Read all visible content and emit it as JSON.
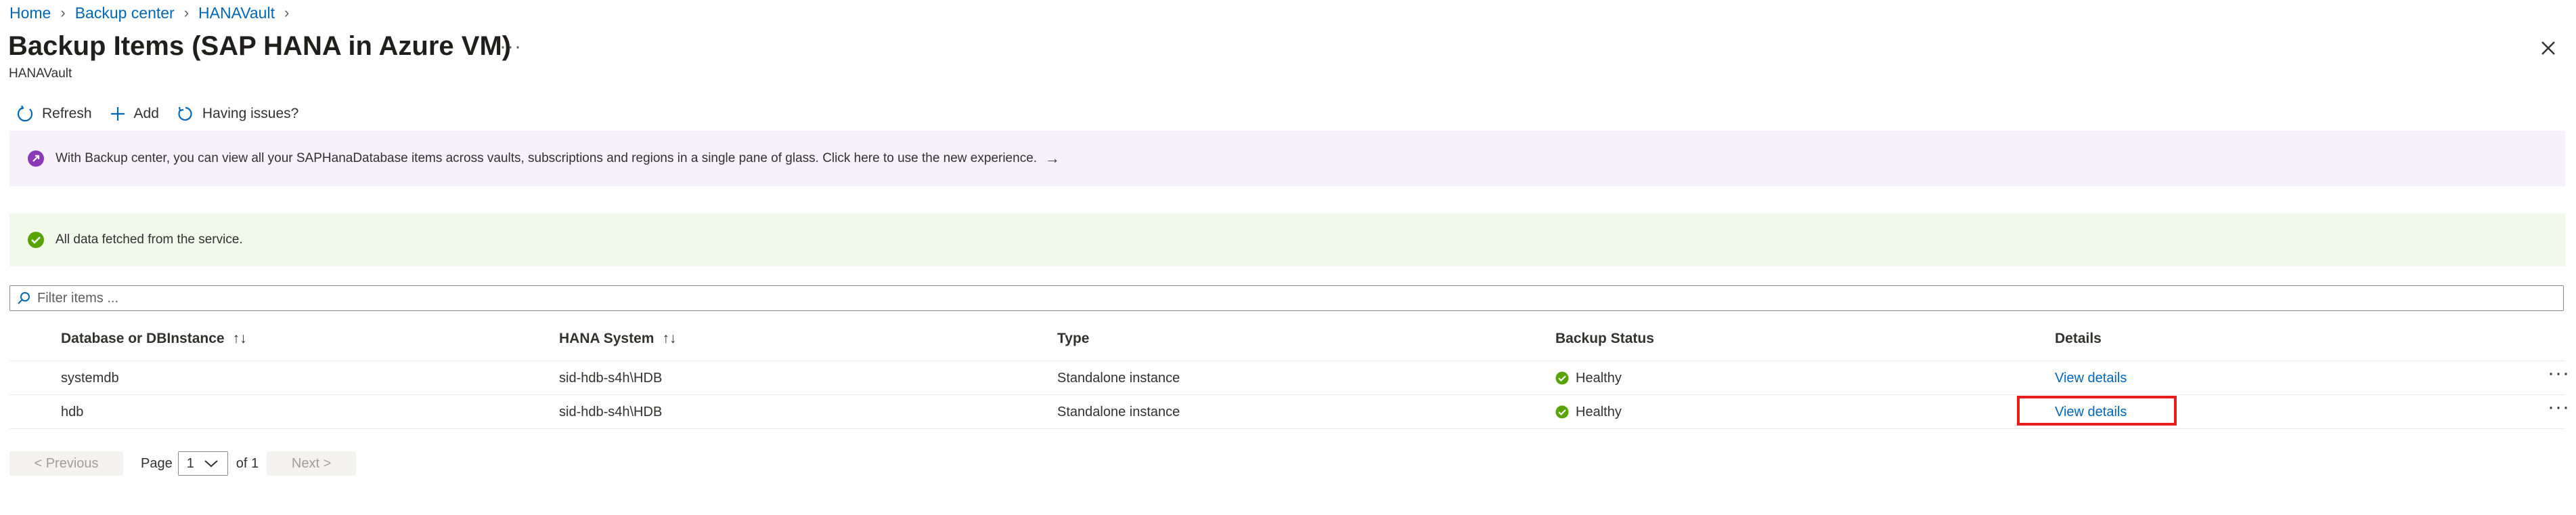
{
  "breadcrumb": [
    "Home",
    "Backup center",
    "HANAVault"
  ],
  "header": {
    "title": "Backup Items (SAP HANA in Azure VM)",
    "more": "···",
    "subtitle": "HANAVault"
  },
  "toolbar": {
    "refresh": "Refresh",
    "add": "Add",
    "issues": "Having issues?"
  },
  "banners": {
    "info": "With Backup center, you can view all your SAPHanaDatabase items across vaults, subscriptions and regions in a single pane of glass. Click here to use the new experience.",
    "info_arrow": "→",
    "success": "All data fetched from the service."
  },
  "filter": {
    "placeholder": "Filter items ..."
  },
  "table": {
    "columns": [
      "Database or DBInstance",
      "HANA System",
      "Type",
      "Backup Status",
      "Details"
    ],
    "sort_icon": "↑↓",
    "rows": [
      {
        "db": "systemdb",
        "system": "sid-hdb-s4h\\HDB",
        "type": "Standalone instance",
        "status": "Healthy",
        "details": "View details",
        "more": "···"
      },
      {
        "db": "hdb",
        "system": "sid-hdb-s4h\\HDB",
        "type": "Standalone instance",
        "status": "Healthy",
        "details": "View details",
        "more": "···"
      }
    ]
  },
  "pager": {
    "previous": "< Previous",
    "page_label": "Page",
    "current": "1",
    "of": "of 1",
    "next": "Next >"
  },
  "colors": {
    "accent": "#0067b8",
    "success": "#57a300",
    "highlight": "#e81e1e",
    "purple": "#8a3ab9"
  }
}
